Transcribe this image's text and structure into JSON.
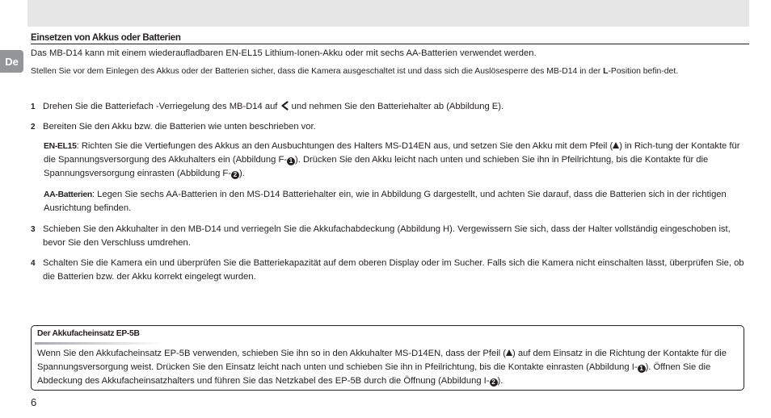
{
  "side_tab": "De",
  "section_title": "Einsetzen von Akkus oder Batterien",
  "intro1": "Das MB-D14 kann mit einem wiederaufladbaren EN-EL15 Lithium-Ionen-Akku oder mit sechs AA-Batterien verwendet werden.",
  "intro2_a": "Stellen Sie vor dem Einlegen des Akkus oder der Batterien sicher, dass die Kamera ausgeschaltet ist und dass sich die Auslösesperre des MB-D14 in der ",
  "intro2_bold": "L",
  "intro2_b": "-Position befin-det.",
  "steps": [
    {
      "num": "1",
      "a": "Drehen Sie die Batteriefach -Verriegelung des MB-D14 auf ",
      "b": " und nehmen Sie den Batteriehalter ab (Abbildung E)."
    },
    {
      "num": "2",
      "text": "Bereiten Sie den Akku bzw. die Batterien wie unten beschrieben vor."
    },
    {
      "num": "3",
      "text": "Schieben Sie den Akkuhalter in den MB-D14 und verriegeln Sie die Akkufachabdeckung (Abbildung H). Vergewissern Sie sich, dass der Halter vollständig eingeschoben ist, bevor Sie den Verschluss umdrehen."
    },
    {
      "num": "4",
      "text": "Schalten Sie die Kamera ein und überprüfen Sie die Batteriekapazität auf dem oberen Display oder im Sucher. Falls sich die Kamera nicht einschalten lässt, überprüfen Sie, ob die Batterien bzw. der Akku korrekt eingelegt wurden."
    }
  ],
  "enel15": {
    "term": "EN-EL15",
    "a": ": Richten Sie die Vertiefungen des Akkus an den Ausbuchtungen des Halters MS-D14EN aus, und setzen Sie den Akku mit dem Pfeil (",
    "b": ") in Rich-tung der Kontakte für die Spannungsversorgung des Akkuhalters ein (Abbildung F-",
    "c": "). Drücken Sie den Akku leicht nach unten und schieben Sie ihn in Pfeilrichtung, bis die Kontakte für die Spannungsversorgung einrasten (Abbildung F-",
    "d": ")."
  },
  "aa": {
    "term": "AA-Batterien",
    "text": ": Legen Sie sechs AA-Batterien in den MS-D14 Batteriehalter ein, wie in Abbildung G dargestellt, und achten Sie darauf, dass die Batterien sich in der richtigen Ausrichtung befinden."
  },
  "box": {
    "title": "Der Akkufacheinsatz EP-5B",
    "a": "Wenn Sie den Akkufacheinsatz EP-5B verwenden, schieben Sie ihn so in den Akkuhalter MS-D14EN, dass der Pfeil (",
    "b": ") auf dem Einsatz in die Richtung der Kontakte für die Spannungsversorgung weist. Drücken Sie den Einsatz leicht nach unten und schieben Sie ihn in Pfeilrichtung, bis die Kontakte einrasten (Abbildung I-",
    "c": "). Öffnen Sie die Abdeckung des Akkufacheinsatzhalters und führen Sie das Netzkabel des EP-5B durch die Öffnung (Abbildung I-",
    "d": ")."
  },
  "callout_1": "1",
  "callout_2": "2",
  "page_number": "6"
}
